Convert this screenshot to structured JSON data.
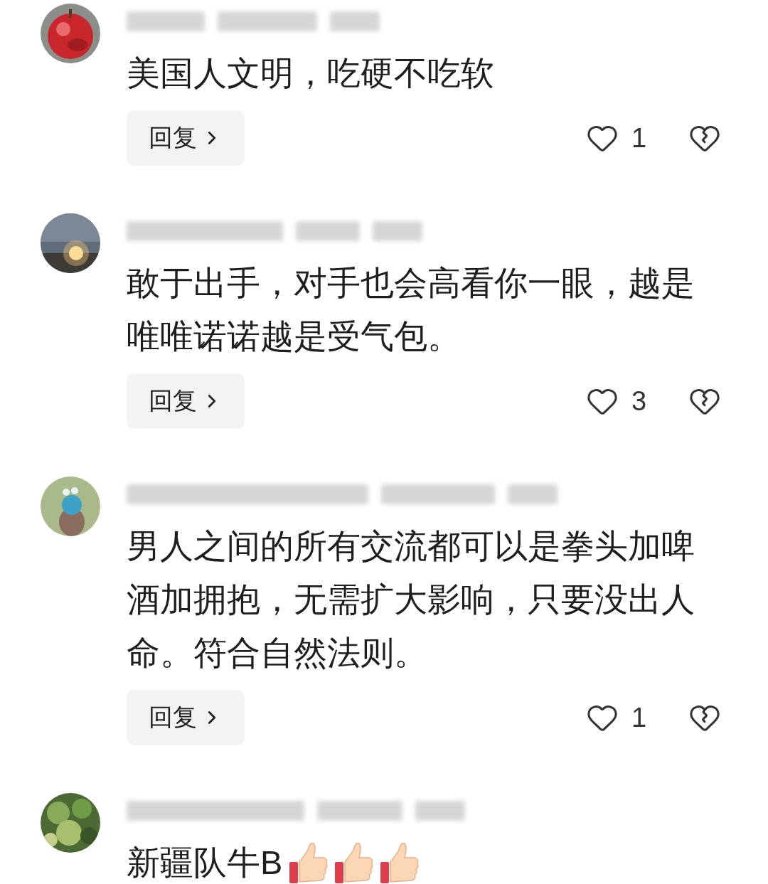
{
  "comments": [
    {
      "text": "美国人文明，吃硬不吃软",
      "reply_label": "回复",
      "likes": "1"
    },
    {
      "text": "敢于出手，对手也会高看你一眼，越是唯唯诺诺越是受气包。",
      "reply_label": "回复",
      "likes": "3"
    },
    {
      "text": "男人之间的所有交流都可以是拳头加啤酒加拥抱，无需扩大影响，只要没出人命。符合自然法则。",
      "reply_label": "回复",
      "likes": "1"
    },
    {
      "text": "新疆队牛B",
      "emojis": [
        {
          "kind": "thumbs_up"
        },
        {
          "kind": "thumbs_up"
        },
        {
          "kind": "thumbs_up"
        }
      ]
    }
  ]
}
